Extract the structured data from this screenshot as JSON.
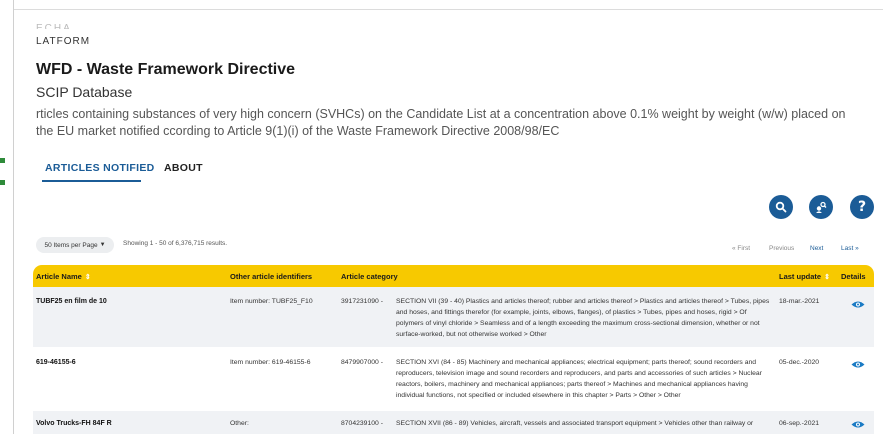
{
  "header": {
    "platform": "LATFORM",
    "title": "WFD - Waste Framework Directive",
    "subtitle": "SCIP Database",
    "description": "rticles containing substances of very high concern (SVHCs) on the Candidate List at a concentration above 0.1% weight by weight (w/w) placed on the EU market notified ccording to Article 9(1)(i) of the Waste Framework Directive 2008/98/EC"
  },
  "tabs": [
    {
      "label": "ARTICLES NOTIFIED",
      "active": true
    },
    {
      "label": "ABOUT",
      "active": false
    }
  ],
  "toolbar": {
    "search_icon": "search-icon",
    "filter_icon": "user-search-icon",
    "help_label": "?"
  },
  "pagination": {
    "per_page_label": "50 Items per Page",
    "showing": "Showing 1 - 50 of 6,376,715 results.",
    "first": "« First",
    "previous": "Previous",
    "next": "Next",
    "last": "Last »"
  },
  "table": {
    "columns": [
      "Article Name",
      "Other article identifiers",
      "Article category",
      "Last update",
      "Details"
    ],
    "rows": [
      {
        "name": "TUBF25 en film de 10",
        "identifiers": "Item number: TUBF25_F10",
        "code": "3917231090 -",
        "category": "SECTION VII (39 - 40) Plastics and articles thereof; rubber and articles thereof > Plastics and articles thereof > Tubes, pipes and hoses, and fittings therefor (for example, joints, elbows, flanges), of plastics > Tubes, pipes and hoses, rigid > Of polymers of vinyl chloride > Seamless and of a length exceeding the maximum cross-sectional dimension, whether or not surface-worked, but not otherwise worked > Other",
        "updated": "18-mar.-2021"
      },
      {
        "name": "619-46155-6",
        "identifiers": "Item number: 619-46155-6",
        "code": "8479907000 -",
        "category": "SECTION XVI (84 - 85) Machinery and mechanical appliances; electrical equipment; parts thereof; sound recorders and reproducers, television image and sound recorders and reproducers, and parts and accessories of such articles > Nuclear reactors, boilers, machinery and mechanical appliances; parts thereof > Machines and mechanical appliances having individual functions, not specified or included elsewhere in this chapter > Parts > Other > Other",
        "updated": "05-dec.-2020"
      },
      {
        "name": "Volvo Trucks-FH 84F R",
        "identifiers": "Other:",
        "code": "8704239100 -",
        "category": "SECTION XVII (86 - 89) Vehicles, aircraft, vessels and associated transport equipment > Vehicles other than railway or",
        "updated": "06-sep.-2021"
      }
    ]
  },
  "colors": {
    "accent": "#1b5c97",
    "header_bar": "#f7c900",
    "row_alt": "#f0f2f5"
  }
}
